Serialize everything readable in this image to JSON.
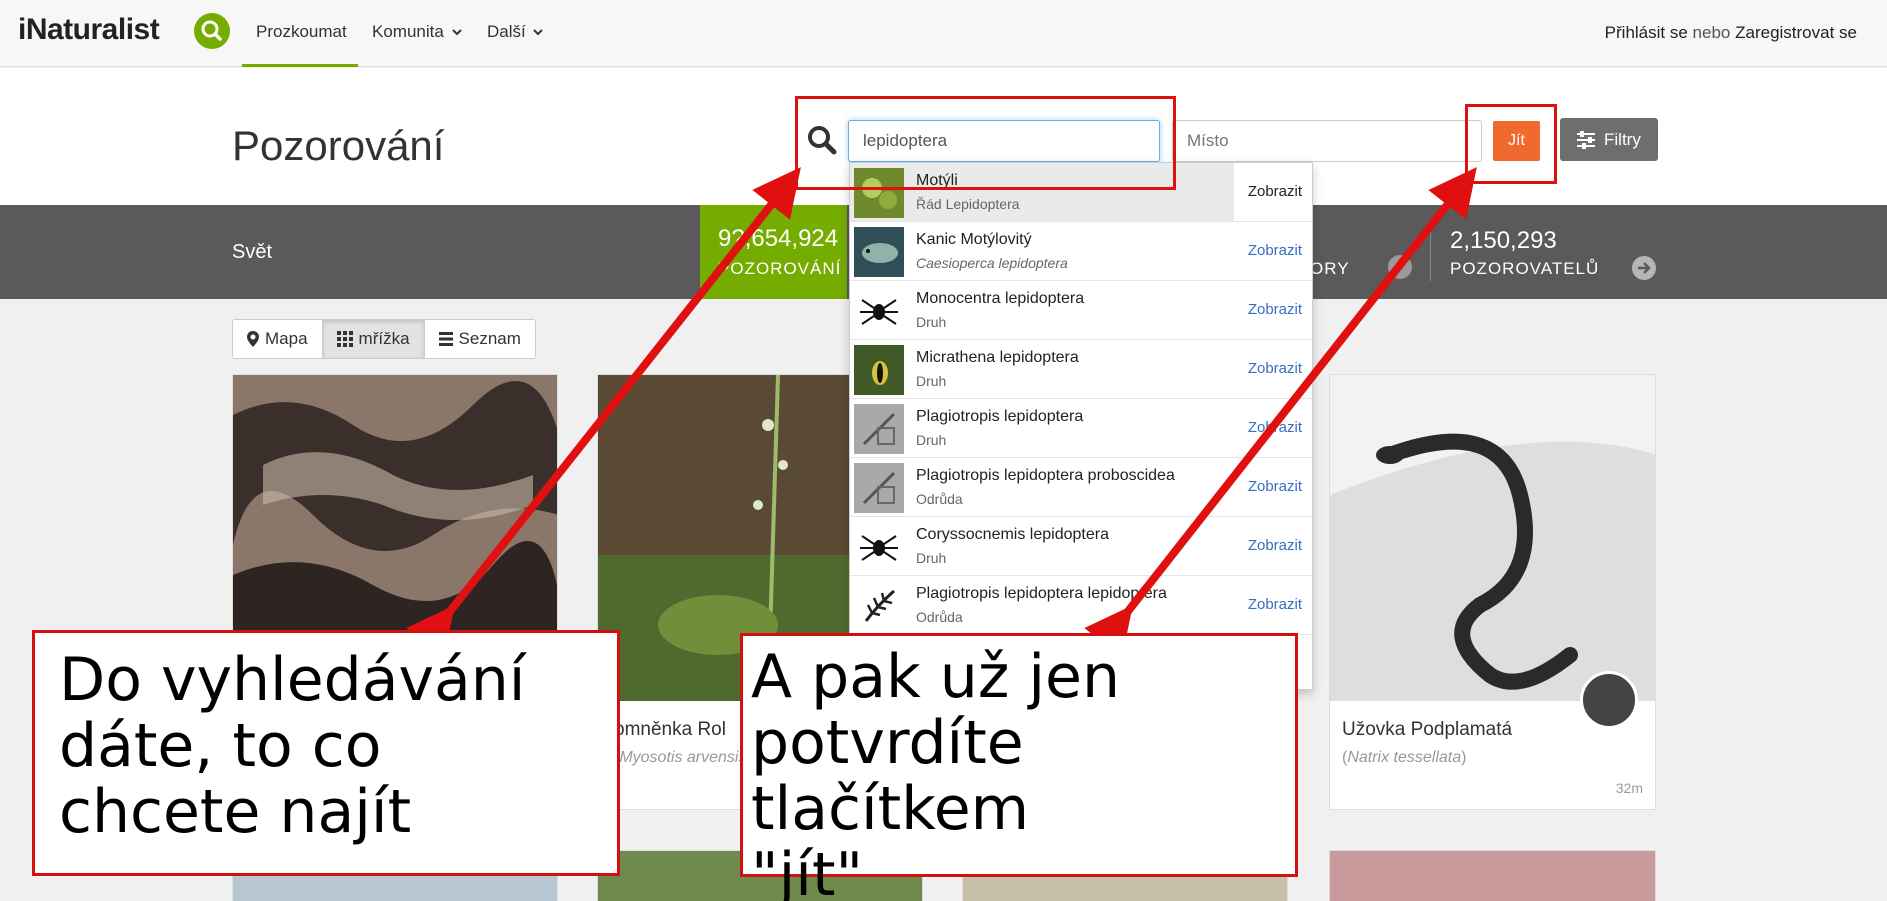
{
  "nav": {
    "logo": "iNaturalist",
    "items": [
      "Prozkoumat",
      "Komunita",
      "Další"
    ],
    "login": "Přihlásit se",
    "or": "nebo",
    "register": "Zaregistrovat se"
  },
  "header": {
    "title": "Pozorování",
    "search_value": "lepidoptera",
    "place_placeholder": "Místo",
    "go_label": "Jít",
    "filters_label": "Filtry"
  },
  "stats": {
    "place": "Svět",
    "observations_num": "9?,654,924",
    "observations_lbl": "POZOROVÁNÍ",
    "partial_lbl": "ORY",
    "observers_num": "2,150,293",
    "observers_lbl": "POZOROVATELŮ"
  },
  "view_toggle": {
    "map": "Mapa",
    "grid": "mřížka",
    "list": "Seznam"
  },
  "cards": [
    {
      "title": "omněnka Rol",
      "sci": "Myosotis arvensis"
    },
    {
      "title": "Užovka Podplamatá",
      "sci": "Natrix tessellata",
      "time": "32m"
    }
  ],
  "dropdown": [
    {
      "name": "Motýli",
      "rank": "Řád Lepidoptera",
      "sci": false,
      "view": "Zobrazit",
      "thumb": "green"
    },
    {
      "name": "Kanic Motýlovitý",
      "rank": "Caesioperca lepidoptera",
      "sci": true,
      "view": "Zobrazit",
      "thumb": "fish"
    },
    {
      "name": "Monocentra lepidoptera",
      "rank": "Druh",
      "sci": false,
      "view": "Zobrazit",
      "thumb": "spider"
    },
    {
      "name": "Micrathena lepidoptera",
      "rank": "Druh",
      "sci": false,
      "view": "Zobrazit",
      "thumb": "spider-photo"
    },
    {
      "name": "Plagiotropis lepidoptera",
      "rank": "Druh",
      "sci": false,
      "view": "Zobrazit",
      "thumb": "gray"
    },
    {
      "name": "Plagiotropis lepidoptera proboscidea",
      "rank": "Odrůda",
      "sci": false,
      "view": "Zobrazit",
      "thumb": "gray"
    },
    {
      "name": "Coryssocnemis lepidoptera",
      "rank": "Druh",
      "sci": false,
      "view": "Zobrazit",
      "thumb": "spider"
    },
    {
      "name": "Plagiotropis lepidoptera lepidoptera",
      "rank": "Odrůda",
      "sci": false,
      "view": "Zobrazit",
      "thumb": "fern"
    }
  ],
  "annotations": {
    "left_callout": [
      "Do vyhledávání",
      "dáte, to co",
      "chcete najít"
    ],
    "right_callout": [
      "A pak už jen",
      "potvrdíte tlačítkem",
      "\"jít\""
    ]
  },
  "colors": {
    "accent": "#74ac00",
    "go": "#f0692e",
    "annotation": "#e01010"
  }
}
